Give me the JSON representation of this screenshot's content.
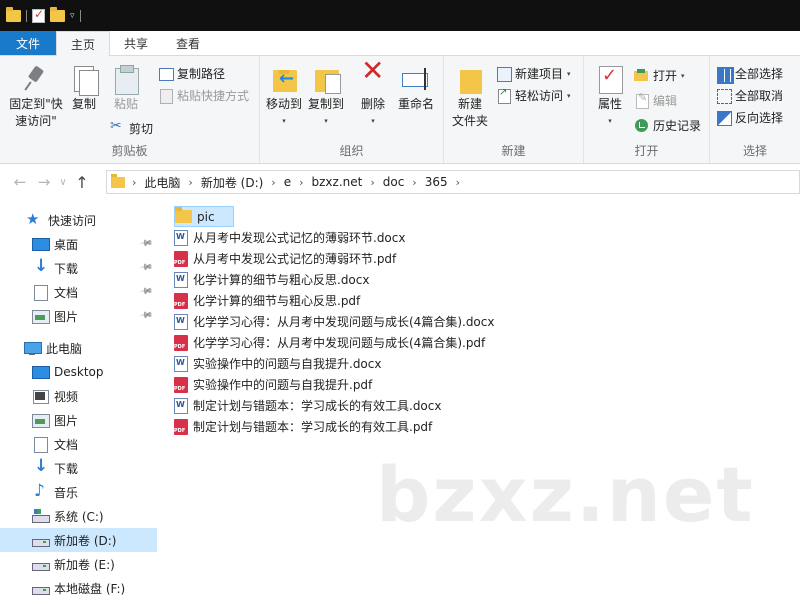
{
  "window": {
    "titlebar_arrow": "▿"
  },
  "tabs": {
    "file": "文件",
    "home": "主页",
    "share": "共享",
    "view": "查看"
  },
  "ribbon": {
    "clipboard": {
      "label": "剪贴板",
      "pin_quick": "固定到\"快\n速访问\"",
      "copy": "复制",
      "paste": "粘贴",
      "copy_path": "复制路径",
      "paste_shortcut": "粘贴快捷方式",
      "cut": "剪切"
    },
    "organize": {
      "label": "组织",
      "move_to": "移动到",
      "copy_to": "复制到",
      "delete": "删除",
      "rename": "重命名"
    },
    "new": {
      "label": "新建",
      "new_folder": "新建\n文件夹",
      "new_item": "新建项目",
      "easy_access": "轻松访问"
    },
    "open": {
      "label": "打开",
      "properties": "属性",
      "open": "打开",
      "edit": "编辑",
      "history": "历史记录"
    },
    "select": {
      "label": "选择",
      "select_all": "全部选择",
      "select_none": "全部取消",
      "invert": "反向选择"
    },
    "dropdown_glyph": "▾"
  },
  "nav": {
    "back": "←",
    "forward": "→",
    "recent": "∨",
    "up": "↑"
  },
  "address": {
    "chevron": "›",
    "segments": [
      "此电脑",
      "新加卷 (D:)",
      "e",
      "bzxz.net",
      "doc",
      "365"
    ]
  },
  "sidebar": {
    "pin_glyph": "📌",
    "items": [
      {
        "label": "快速访问"
      },
      {
        "label": "桌面"
      },
      {
        "label": "下载"
      },
      {
        "label": "文档"
      },
      {
        "label": "图片"
      },
      {
        "label": "此电脑"
      },
      {
        "label": "Desktop"
      },
      {
        "label": "视频"
      },
      {
        "label": "图片"
      },
      {
        "label": "文档"
      },
      {
        "label": "下载"
      },
      {
        "label": "音乐"
      },
      {
        "label": "系统 (C:)"
      },
      {
        "label": "新加卷 (D:)"
      },
      {
        "label": "新加卷 (E:)"
      },
      {
        "label": "本地磁盘 (F:)"
      }
    ]
  },
  "files": [
    {
      "name": "pic",
      "type": "folder"
    },
    {
      "name": "从月考中发现公式记忆的薄弱环节.docx",
      "type": "word"
    },
    {
      "name": "从月考中发现公式记忆的薄弱环节.pdf",
      "type": "pdf"
    },
    {
      "name": "化学计算的细节与粗心反思.docx",
      "type": "word"
    },
    {
      "name": "化学计算的细节与粗心反思.pdf",
      "type": "pdf"
    },
    {
      "name": "化学学习心得：从月考中发现问题与成长(4篇合集).docx",
      "type": "word"
    },
    {
      "name": "化学学习心得：从月考中发现问题与成长(4篇合集).pdf",
      "type": "pdf"
    },
    {
      "name": "实验操作中的问题与自我提升.docx",
      "type": "word"
    },
    {
      "name": "实验操作中的问题与自我提升.pdf",
      "type": "pdf"
    },
    {
      "name": "制定计划与错题本：学习成长的有效工具.docx",
      "type": "word"
    },
    {
      "name": "制定计划与错题本：学习成长的有效工具.pdf",
      "type": "pdf"
    }
  ],
  "watermark": "bzxz.net",
  "colors": {
    "file_tab": "#1979ca",
    "selection": "#cce8ff",
    "folder": "#f3c64a"
  }
}
